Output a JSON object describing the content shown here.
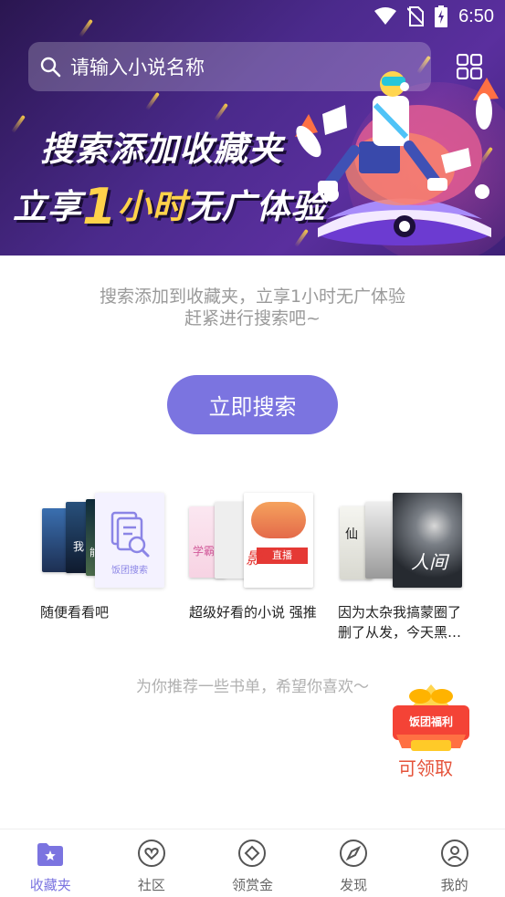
{
  "status": {
    "time": "6:50"
  },
  "search": {
    "placeholder": "请输入小说名称"
  },
  "banner": {
    "title_line1": "搜索添加收藏夹",
    "title_line2_prefix": "立享",
    "title_line2_num": "1",
    "title_line2_mid": "小时",
    "title_line2_suffix": "无广体验"
  },
  "promo": {
    "line1": "搜索添加到收藏夹，立享1小时无广体验",
    "line2": "赶紧进行搜索吧~"
  },
  "search_button": {
    "label": "立即搜索"
  },
  "recommendations": [
    {
      "title": "随便看看吧",
      "badge": "饭团搜索"
    },
    {
      "title": "超级好看的小说 强推"
    },
    {
      "title": "因为太杂我搞蒙圈了 删了从发，今天黑…"
    }
  ],
  "rec_hint": "为你推荐一些书单，希望你喜欢〜",
  "welfare": {
    "badge": "饭团福利",
    "label": "可领取"
  },
  "nav": [
    {
      "label": "收藏夹",
      "icon": "bookmark-folder-icon",
      "active": true
    },
    {
      "label": "社区",
      "icon": "heart-chat-icon"
    },
    {
      "label": "领赏金",
      "icon": "diamond-coin-icon"
    },
    {
      "label": "发现",
      "icon": "compass-icon"
    },
    {
      "label": "我的",
      "icon": "person-icon"
    }
  ],
  "colors": {
    "accent": "#7b74e0",
    "banner": "#4b2a8c",
    "welfare": "#e5533a",
    "highlight": "#ffd24a"
  }
}
